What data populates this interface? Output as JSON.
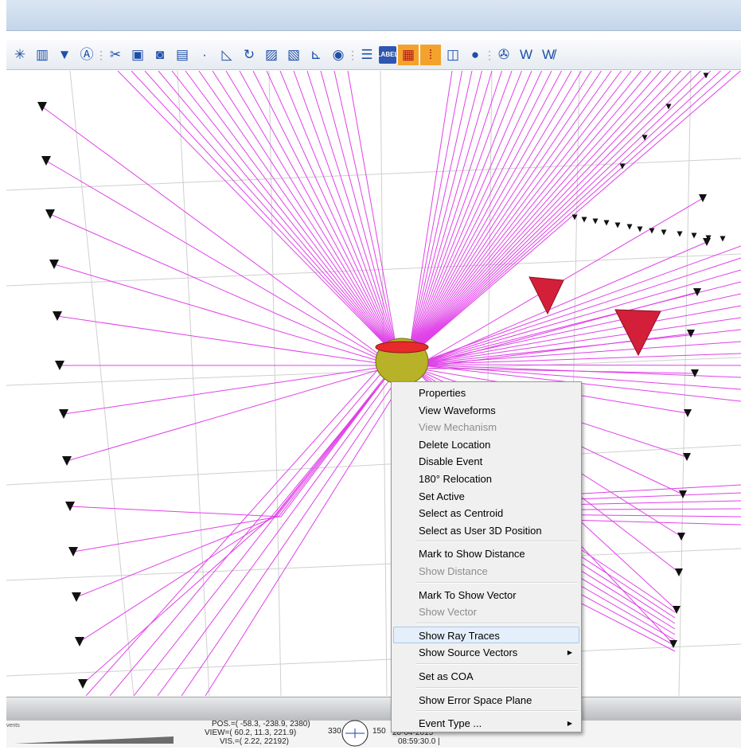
{
  "toolbar": {
    "buttons": [
      {
        "icon": "events-icon",
        "glyph": "✳"
      },
      {
        "icon": "histogram-icon",
        "glyph": "▥"
      },
      {
        "icon": "filter-icon",
        "glyph": "▼"
      },
      {
        "icon": "annotate-icon",
        "glyph": "Ⓐ"
      },
      {
        "icon": "tools-icon",
        "glyph": "✂"
      },
      {
        "icon": "frame-icon",
        "glyph": "▣"
      },
      {
        "icon": "camera-icon",
        "glyph": "◙"
      },
      {
        "icon": "column-icon",
        "glyph": "▤"
      },
      {
        "icon": "dot-icon",
        "glyph": "·"
      },
      {
        "icon": "angle-icon",
        "glyph": "◺"
      },
      {
        "icon": "rotate-icon",
        "glyph": "↻"
      },
      {
        "icon": "pattern-a-icon",
        "glyph": "▨"
      },
      {
        "icon": "pattern-b-icon",
        "glyph": "▧"
      },
      {
        "icon": "axes-icon",
        "glyph": "⊾"
      },
      {
        "icon": "target-icon",
        "glyph": "◉"
      },
      {
        "icon": "list-icon",
        "glyph": "☰"
      },
      {
        "icon": "label-icon",
        "glyph": "LABEL"
      },
      {
        "icon": "grid-color-icon",
        "glyph": "▦"
      },
      {
        "icon": "dots-color-icon",
        "glyph": "⁞"
      },
      {
        "icon": "square-frame-icon",
        "glyph": "◫"
      },
      {
        "icon": "sphere-icon",
        "glyph": "●"
      },
      {
        "icon": "fan-icon",
        "glyph": "✇"
      },
      {
        "icon": "w-icon",
        "glyph": "W"
      },
      {
        "icon": "w-cross-icon",
        "glyph": "W̸"
      }
    ]
  },
  "colors": {
    "ray": "#e040e8",
    "event": "#b8b228",
    "event_top": "#e82a2a",
    "sensor": "#111111",
    "cone": "#d41f3a",
    "grid": "#cfcfcf"
  },
  "context_menu": {
    "items": [
      {
        "label": "Properties",
        "disabled": false
      },
      {
        "label": "View Waveforms",
        "disabled": false
      },
      {
        "label": "View Mechanism",
        "disabled": true
      },
      {
        "label": "Delete Location",
        "disabled": false
      },
      {
        "label": "Disable Event",
        "disabled": false
      },
      {
        "label": "180° Relocation",
        "disabled": false
      },
      {
        "label": "Set Active",
        "disabled": false
      },
      {
        "label": "Select as Centroid",
        "disabled": false
      },
      {
        "label": "Select as User 3D Position",
        "disabled": false
      },
      {
        "sep": true
      },
      {
        "label": "Mark to Show Distance",
        "disabled": false
      },
      {
        "label": "Show Distance",
        "disabled": true
      },
      {
        "sep": true
      },
      {
        "label": "Mark To Show Vector",
        "disabled": false
      },
      {
        "label": "Show Vector",
        "disabled": true
      },
      {
        "sep": true
      },
      {
        "label": "Show Ray Traces",
        "disabled": false,
        "hover": true
      },
      {
        "label": "Show Source Vectors",
        "disabled": false,
        "submenu": true
      },
      {
        "sep": true
      },
      {
        "label": "Set as COA",
        "disabled": false
      },
      {
        "sep": true
      },
      {
        "label": "Show Error Space Plane",
        "disabled": false
      },
      {
        "sep": true
      },
      {
        "label": "Event Type ...",
        "disabled": false,
        "submenu": true
      }
    ]
  },
  "status": {
    "left_label": "vents",
    "pos": "POS.=( -58.3, -238.9, 2380)",
    "view": "VIEW=( 60.2,  11.3, 221.9)",
    "vis": "VIS.=( 2.22, 22192)",
    "compass_left": "330",
    "compass_right": "150",
    "date": "20-04-2015",
    "time": "08:59:30.0 |"
  }
}
